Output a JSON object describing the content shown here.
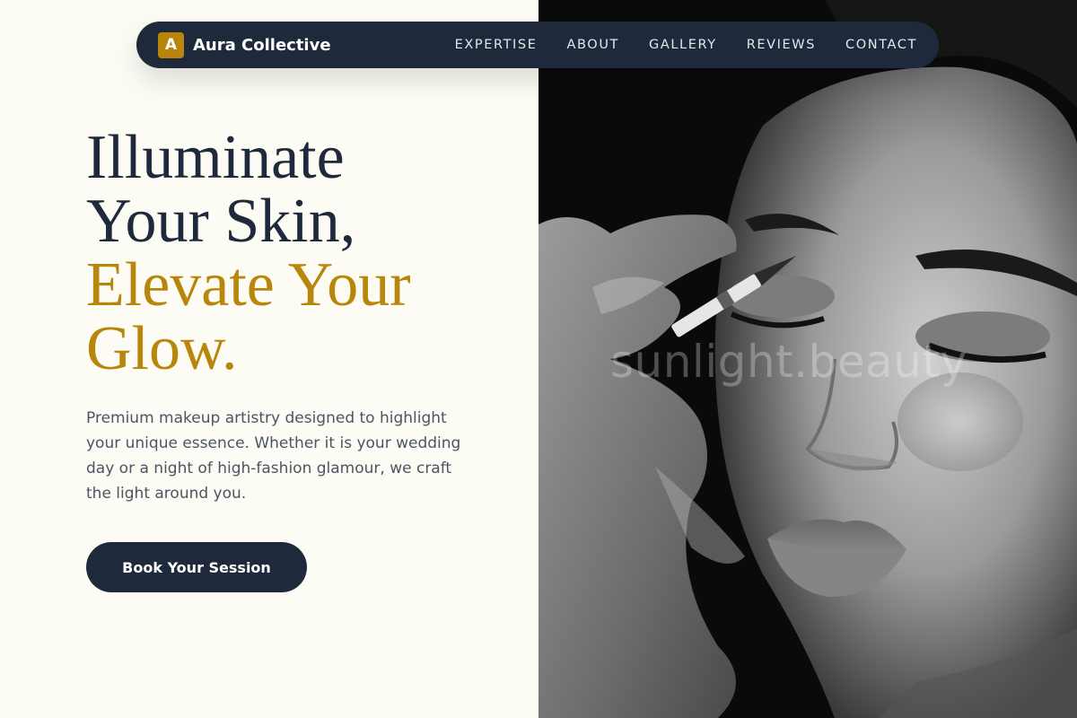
{
  "brand": {
    "logo_letter": "A",
    "name": "Aura Collective",
    "accent_color": "#b8860b",
    "primary_color": "#1e293b"
  },
  "nav": {
    "items": [
      {
        "label": "EXPERTISE"
      },
      {
        "label": "ABOUT"
      },
      {
        "label": "GALLERY"
      },
      {
        "label": "REVIEWS"
      },
      {
        "label": "CONTACT"
      }
    ]
  },
  "hero": {
    "headline_line1": "Illuminate",
    "headline_line2": "Your Skin,",
    "headline_line3": "Elevate Your",
    "headline_line4": "Glow.",
    "description": "Premium makeup artistry designed to highlight your unique essence. Whether it is your wedding day or a night of high-fashion glamour, we craft the light around you.",
    "cta_label": "Book Your Session"
  },
  "image": {
    "watermark": "sunlight.beauty"
  }
}
